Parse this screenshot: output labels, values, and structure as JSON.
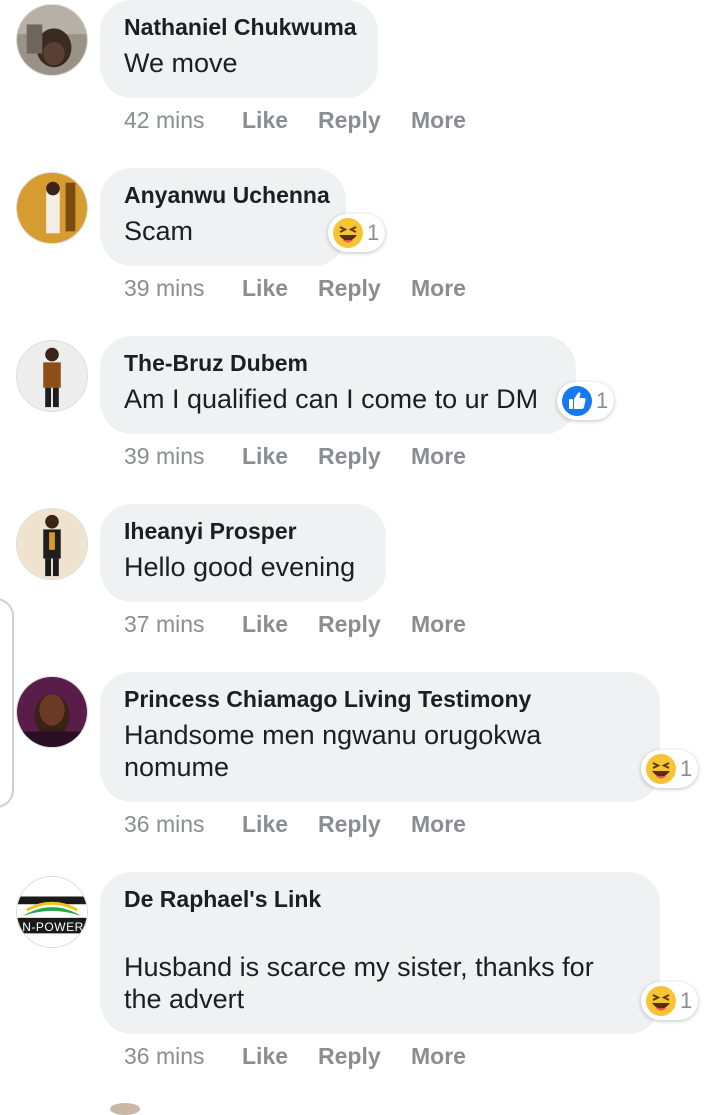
{
  "actions": {
    "like": "Like",
    "reply": "Reply",
    "more": "More"
  },
  "comments": [
    {
      "name": "Nathaniel Chukwuma",
      "text": "We move",
      "time": "42 mins",
      "reaction": null
    },
    {
      "name": "Anyanwu Uchenna",
      "text": "Scam",
      "time": "39 mins",
      "reaction": {
        "icon": "haha-icon",
        "count": "1"
      }
    },
    {
      "name": "The-Bruz Dubem",
      "text": "Am I qualified can I come to ur DM",
      "time": "39 mins",
      "reaction": {
        "icon": "like-icon",
        "count": "1"
      }
    },
    {
      "name": "Iheanyi Prosper",
      "text": "Hello good evening",
      "time": "37 mins",
      "reaction": null
    },
    {
      "name": "Princess Chiamago Living Testimony",
      "text": "Handsome men ngwanu orugokwa nomume",
      "time": "36 mins",
      "reaction": {
        "icon": "haha-icon",
        "count": "1"
      }
    },
    {
      "name": "De Raphael's Link",
      "text": "Husband is scarce my sister, thanks for the advert",
      "time": "36 mins",
      "reaction": {
        "icon": "haha-icon",
        "count": "1"
      }
    }
  ],
  "avatar_logo_text": "N-POWER",
  "colors": {
    "bubble": "#f0f1f3",
    "meta": "#8a8d91",
    "like_blue": "#1877f2",
    "haha_yellow": "#f7c436"
  }
}
